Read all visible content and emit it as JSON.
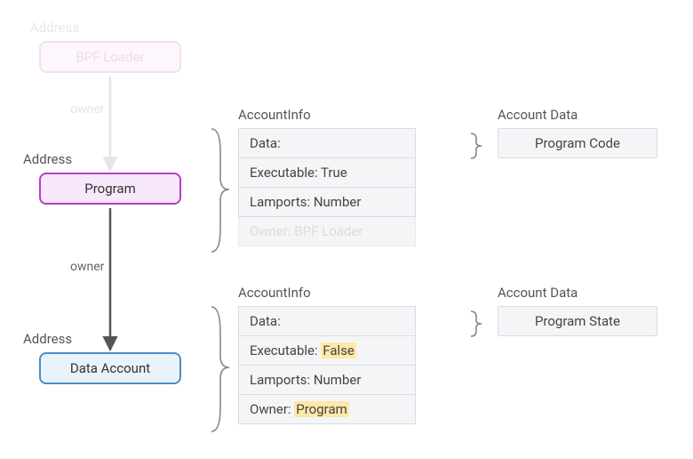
{
  "bpf": {
    "addressLabel": "Address",
    "name": "BPF Loader",
    "ownerEdge": "owner"
  },
  "program": {
    "addressLabel": "Address",
    "name": "Program",
    "ownerEdge": "owner"
  },
  "dataAccount": {
    "addressLabel": "Address",
    "name": "Data Account"
  },
  "info1": {
    "title": "AccountInfo",
    "data": "Data:",
    "executable": "Executable: True",
    "lamports": "Lamports: Number",
    "owner": "Owner: BPF Loader"
  },
  "info2": {
    "title": "AccountInfo",
    "data": "Data:",
    "executablePrefix": "Executable: ",
    "executableValue": "False",
    "lamports": "Lamports: Number",
    "ownerPrefix": "Owner: ",
    "ownerValue": "Program"
  },
  "accountData1": {
    "title": "Account Data",
    "value": "Program Code"
  },
  "accountData2": {
    "title": "Account Data",
    "value": "Program State"
  }
}
